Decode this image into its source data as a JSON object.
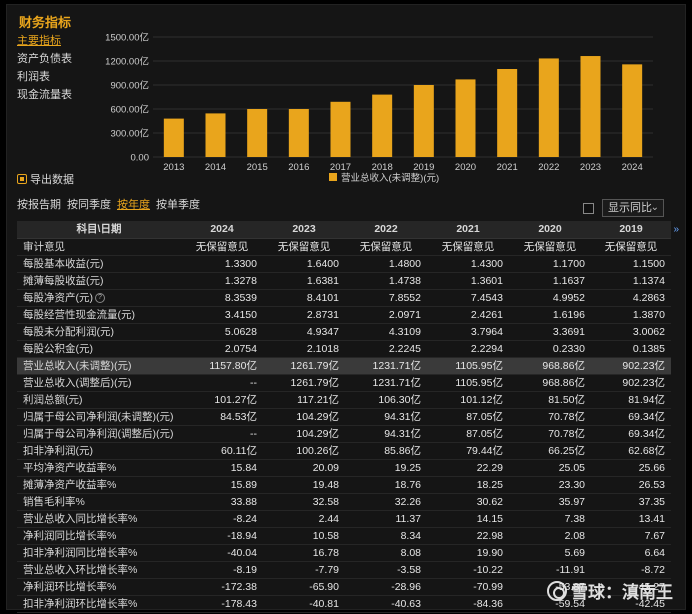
{
  "panel": {
    "title": "财务指标"
  },
  "side_nav": [
    {
      "label": "主要指标",
      "active": true
    },
    {
      "label": "资产负债表",
      "active": false
    },
    {
      "label": "利润表",
      "active": false
    },
    {
      "label": "现金流量表",
      "active": false
    }
  ],
  "export_label": "导出数据",
  "period_tabs": [
    {
      "label": "按报告期",
      "active": false
    },
    {
      "label": "按同季度",
      "active": false
    },
    {
      "label": "按年度",
      "active": true
    },
    {
      "label": "按单季度",
      "active": false
    }
  ],
  "yoy_select": {
    "value": "显示同比",
    "chevron": "⌄"
  },
  "more_cols_glyph": "»",
  "colors": {
    "accent": "#e9a51c",
    "bar": "#e9a51c",
    "highlight_row": "#3a3a3a"
  },
  "chart_data": {
    "type": "bar",
    "categories": [
      "2013",
      "2014",
      "2015",
      "2016",
      "2017",
      "2018",
      "2019",
      "2020",
      "2021",
      "2022",
      "2023",
      "2024"
    ],
    "values": [
      480,
      545,
      600,
      600,
      690,
      780,
      900,
      970,
      1100,
      1232,
      1262,
      1158
    ],
    "yticks": [
      "0.00",
      "300.00亿",
      "600.00亿",
      "900.00亿",
      "1200.00亿",
      "1500.00亿"
    ],
    "ylim": [
      0,
      1500
    ],
    "legend": "营业总收入(未调整)(元)",
    "grid": true
  },
  "table": {
    "header_label": "科目\\日期",
    "columns": [
      "2024",
      "2023",
      "2022",
      "2021",
      "2020",
      "2019"
    ],
    "rows": [
      {
        "label": "审计意见",
        "values": [
          "无保留意见",
          "无保留意见",
          "无保留意见",
          "无保留意见",
          "无保留意见",
          "无保留意见"
        ]
      },
      {
        "label": "每股基本收益(元)",
        "values": [
          "1.3300",
          "1.6400",
          "1.4800",
          "1.4300",
          "1.1700",
          "1.1500"
        ]
      },
      {
        "label": "摊薄每股收益(元)",
        "values": [
          "1.3278",
          "1.6381",
          "1.4738",
          "1.3601",
          "1.1637",
          "1.1374"
        ]
      },
      {
        "label": "每股净资产(元)",
        "values": [
          "8.3539",
          "8.4101",
          "7.8552",
          "7.4543",
          "4.9952",
          "4.2863"
        ],
        "info": "?"
      },
      {
        "label": "每股经营性现金流量(元)",
        "values": [
          "3.4150",
          "2.8731",
          "2.0971",
          "2.4261",
          "1.6196",
          "1.3870"
        ]
      },
      {
        "label": "每股未分配利润(元)",
        "values": [
          "5.0628",
          "4.9347",
          "4.3109",
          "3.7964",
          "3.3691",
          "3.0062"
        ]
      },
      {
        "label": "每股公积金(元)",
        "values": [
          "2.0754",
          "2.1018",
          "2.2245",
          "2.2294",
          "0.2330",
          "0.1385"
        ]
      },
      {
        "label": "营业总收入(未调整)(元)",
        "values": [
          "1157.80亿",
          "1261.79亿",
          "1231.71亿",
          "1105.95亿",
          "968.86亿",
          "902.23亿"
        ],
        "highlight": true
      },
      {
        "label": "营业总收入(调整后)(元)",
        "values": [
          "--",
          "1261.79亿",
          "1231.71亿",
          "1105.95亿",
          "968.86亿",
          "902.23亿"
        ]
      },
      {
        "label": "利润总额(元)",
        "values": [
          "101.27亿",
          "117.21亿",
          "106.30亿",
          "101.12亿",
          "81.50亿",
          "81.94亿"
        ]
      },
      {
        "label": "归属于母公司净利润(未调整)(元)",
        "values": [
          "84.53亿",
          "104.29亿",
          "94.31亿",
          "87.05亿",
          "70.78亿",
          "69.34亿"
        ]
      },
      {
        "label": "归属于母公司净利润(调整后)(元)",
        "values": [
          "--",
          "104.29亿",
          "94.31亿",
          "87.05亿",
          "70.78亿",
          "69.34亿"
        ]
      },
      {
        "label": "扣非净利润(元)",
        "values": [
          "60.11亿",
          "100.26亿",
          "85.86亿",
          "79.44亿",
          "66.25亿",
          "62.68亿"
        ]
      },
      {
        "label": "平均净资产收益率%",
        "values": [
          "15.84",
          "20.09",
          "19.25",
          "22.29",
          "25.05",
          "25.66"
        ]
      },
      {
        "label": "摊薄净资产收益率%",
        "values": [
          "15.89",
          "19.48",
          "18.76",
          "18.25",
          "23.30",
          "26.53"
        ]
      },
      {
        "label": "销售毛利率%",
        "values": [
          "33.88",
          "32.58",
          "32.26",
          "30.62",
          "35.97",
          "37.35"
        ]
      },
      {
        "label": "营业总收入同比增长率%",
        "values": [
          "-8.24",
          "2.44",
          "11.37",
          "14.15",
          "7.38",
          "13.41"
        ]
      },
      {
        "label": "净利润同比增长率%",
        "values": [
          "-18.94",
          "10.58",
          "8.34",
          "22.98",
          "2.08",
          "7.67"
        ]
      },
      {
        "label": "扣非净利润同比增长率%",
        "values": [
          "-40.04",
          "16.78",
          "8.08",
          "19.90",
          "5.69",
          "6.64"
        ]
      },
      {
        "label": "营业总收入环比增长率%",
        "values": [
          "-8.19",
          "-7.79",
          "-3.58",
          "-10.22",
          "-11.91",
          "-8.72"
        ]
      },
      {
        "label": "净利润环比增长率%",
        "values": [
          "-172.38",
          "-65.90",
          "-28.96",
          "-70.99",
          "-53.87",
          "-45.27"
        ]
      },
      {
        "label": "扣非净利润环比增长率%",
        "values": [
          "-178.43",
          "-40.81",
          "-40.63",
          "-84.36",
          "-59.54",
          "-42.45"
        ]
      }
    ]
  },
  "watermark": {
    "text": "雪球：滇南王"
  }
}
